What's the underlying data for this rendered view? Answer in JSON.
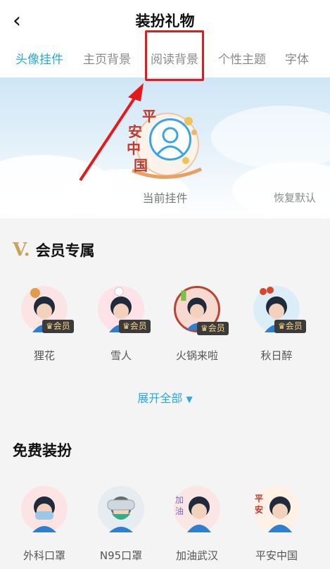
{
  "header": {
    "back_icon": "chevron-left-icon",
    "back_glyph": "‹",
    "title": "装扮礼物"
  },
  "tabs": [
    {
      "label": "头像挂件",
      "active": true
    },
    {
      "label": "主页背景",
      "active": false
    },
    {
      "label": "阅读背景",
      "active": false
    },
    {
      "label": "个性主题",
      "active": false
    },
    {
      "label": "字体",
      "active": false
    }
  ],
  "banner": {
    "current_label": "当前挂件",
    "restore_label": "恢复默认",
    "pendant_text": "平安中国"
  },
  "vip_section": {
    "icon_glyph": "V.",
    "title": "会员专属",
    "badge_label": "会员",
    "items": [
      {
        "label": "狸花",
        "color": "#fde4e4"
      },
      {
        "label": "雪人",
        "color": "#fde2e8"
      },
      {
        "label": "火锅来啦",
        "color": "#f7d9d2"
      },
      {
        "label": "秋日醉",
        "color": "#dbeef7"
      }
    ],
    "expand_label": "展开全部",
    "expand_icon": "triangle-down-icon"
  },
  "free_section": {
    "title": "免费装扮",
    "items": [
      {
        "label": "外科口罩",
        "color": "#fde4e4"
      },
      {
        "label": "N95口罩",
        "color": "#e6ecef"
      },
      {
        "label": "加油武汉",
        "color": "#fbe6e6"
      },
      {
        "label": "平安中国",
        "color": "#fff1e6"
      }
    ]
  },
  "colors": {
    "accent": "#29a9e0",
    "annotation_red": "#e5191a",
    "vip_gold": "#c9a35a"
  }
}
